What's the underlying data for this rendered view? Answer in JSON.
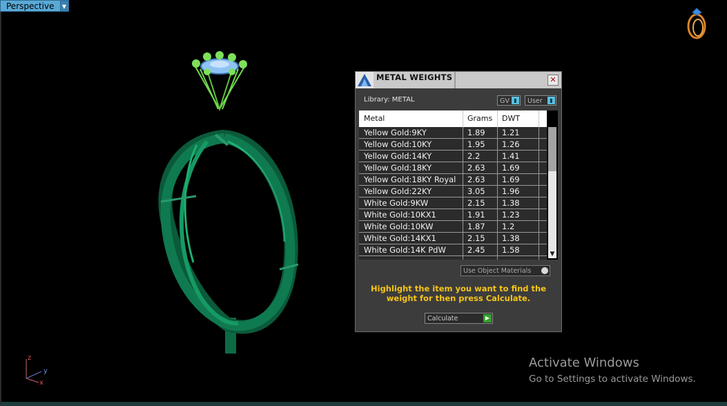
{
  "viewport": {
    "view_label": "Perspective",
    "axes": {
      "x": "x",
      "y": "y",
      "z": "z"
    }
  },
  "metal_weights": {
    "title": "METAL WEIGHTS",
    "library": "Library: METAL",
    "toggle_gv": "GV",
    "toggle_user": "User",
    "columns": [
      "Metal",
      "Grams",
      "DWT"
    ],
    "rows": [
      [
        "Yellow Gold:9KY",
        "1.89",
        "1.21"
      ],
      [
        "Yellow Gold:10KY",
        "1.95",
        "1.26"
      ],
      [
        "Yellow Gold:14KY",
        "2.2",
        "1.41"
      ],
      [
        "Yellow Gold:18KY",
        "2.63",
        "1.69"
      ],
      [
        "Yellow Gold:18KY Royal",
        "2.63",
        "1.69"
      ],
      [
        "Yellow Gold:22KY",
        "3.05",
        "1.96"
      ],
      [
        "White Gold:9KW",
        "2.15",
        "1.38"
      ],
      [
        "White Gold:10KX1",
        "1.91",
        "1.23"
      ],
      [
        "White Gold:10KW",
        "1.87",
        "1.2"
      ],
      [
        "White Gold:14KX1",
        "2.15",
        "1.38"
      ],
      [
        "White Gold:14K PdW",
        "2.45",
        "1.58"
      ]
    ],
    "use_object_materials": "Use Object Materials",
    "instruction": "Highlight the item you want to find the weight for then press Calculate.",
    "calculate": "Calculate"
  },
  "windows_watermark": {
    "title": "Activate Windows",
    "subtitle": "Go to Settings to activate Windows."
  },
  "colors": {
    "ring_green": "#0f6b47",
    "prong_green": "#7ee05a",
    "gem_blue": "#7fb6f0",
    "instruction_yellow": "#f5c518"
  }
}
